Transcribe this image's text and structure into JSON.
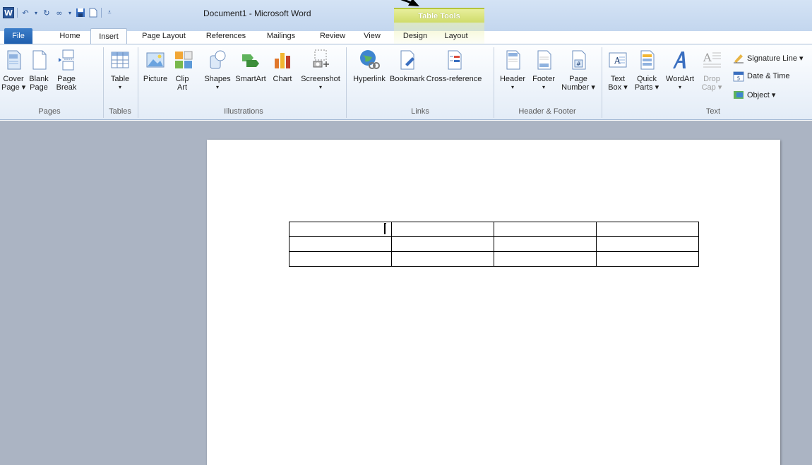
{
  "window": {
    "title": "Document1 - Microsoft Word"
  },
  "contextual_tab_group": {
    "label": "Table Tools"
  },
  "tabs": [
    {
      "label": "File"
    },
    {
      "label": "Home"
    },
    {
      "label": "Insert"
    },
    {
      "label": "Page Layout"
    },
    {
      "label": "References"
    },
    {
      "label": "Mailings"
    },
    {
      "label": "Review"
    },
    {
      "label": "View"
    },
    {
      "label": "Design"
    },
    {
      "label": "Layout"
    }
  ],
  "ribbon": {
    "pages": {
      "label": "Pages",
      "cover_page": {
        "line1": "Cover",
        "line2": "Page ▾"
      },
      "blank_page": {
        "line1": "Blank",
        "line2": "Page"
      },
      "page_break": {
        "line1": "Page",
        "line2": "Break"
      }
    },
    "tables": {
      "label": "Tables",
      "table": {
        "line1": "Table",
        "line2": "▾"
      }
    },
    "illustrations": {
      "label": "Illustrations",
      "picture": {
        "line1": "Picture"
      },
      "clip_art": {
        "line1": "Clip",
        "line2": "Art"
      },
      "shapes": {
        "line1": "Shapes",
        "line2": "▾"
      },
      "smartart": {
        "line1": "SmartArt"
      },
      "chart": {
        "line1": "Chart"
      },
      "screenshot": {
        "line1": "Screenshot",
        "line2": "▾"
      }
    },
    "links": {
      "label": "Links",
      "hyperlink": {
        "line1": "Hyperlink"
      },
      "bookmark": {
        "line1": "Bookmark"
      },
      "cross_reference": {
        "line1": "Cross-reference"
      }
    },
    "header_footer": {
      "label": "Header & Footer",
      "header": {
        "line1": "Header",
        "line2": "▾"
      },
      "footer": {
        "line1": "Footer",
        "line2": "▾"
      },
      "page_number": {
        "line1": "Page",
        "line2": "Number ▾"
      }
    },
    "text": {
      "label": "Text",
      "text_box": {
        "line1": "Text",
        "line2": "Box ▾"
      },
      "quick_parts": {
        "line1": "Quick",
        "line2": "Parts ▾"
      },
      "wordart": {
        "line1": "WordArt",
        "line2": "▾"
      },
      "drop_cap": {
        "line1": "Drop",
        "line2": "Cap ▾"
      },
      "signature_line": "Signature Line ▾",
      "date_time": "Date & Time",
      "object": "Object ▾"
    }
  },
  "document": {
    "table": {
      "rows": 3,
      "cols": 4
    }
  },
  "colors": {
    "file_tab": "#2b67b8",
    "contextual": "#cfdc6a",
    "workspace": "#abb4c3"
  }
}
